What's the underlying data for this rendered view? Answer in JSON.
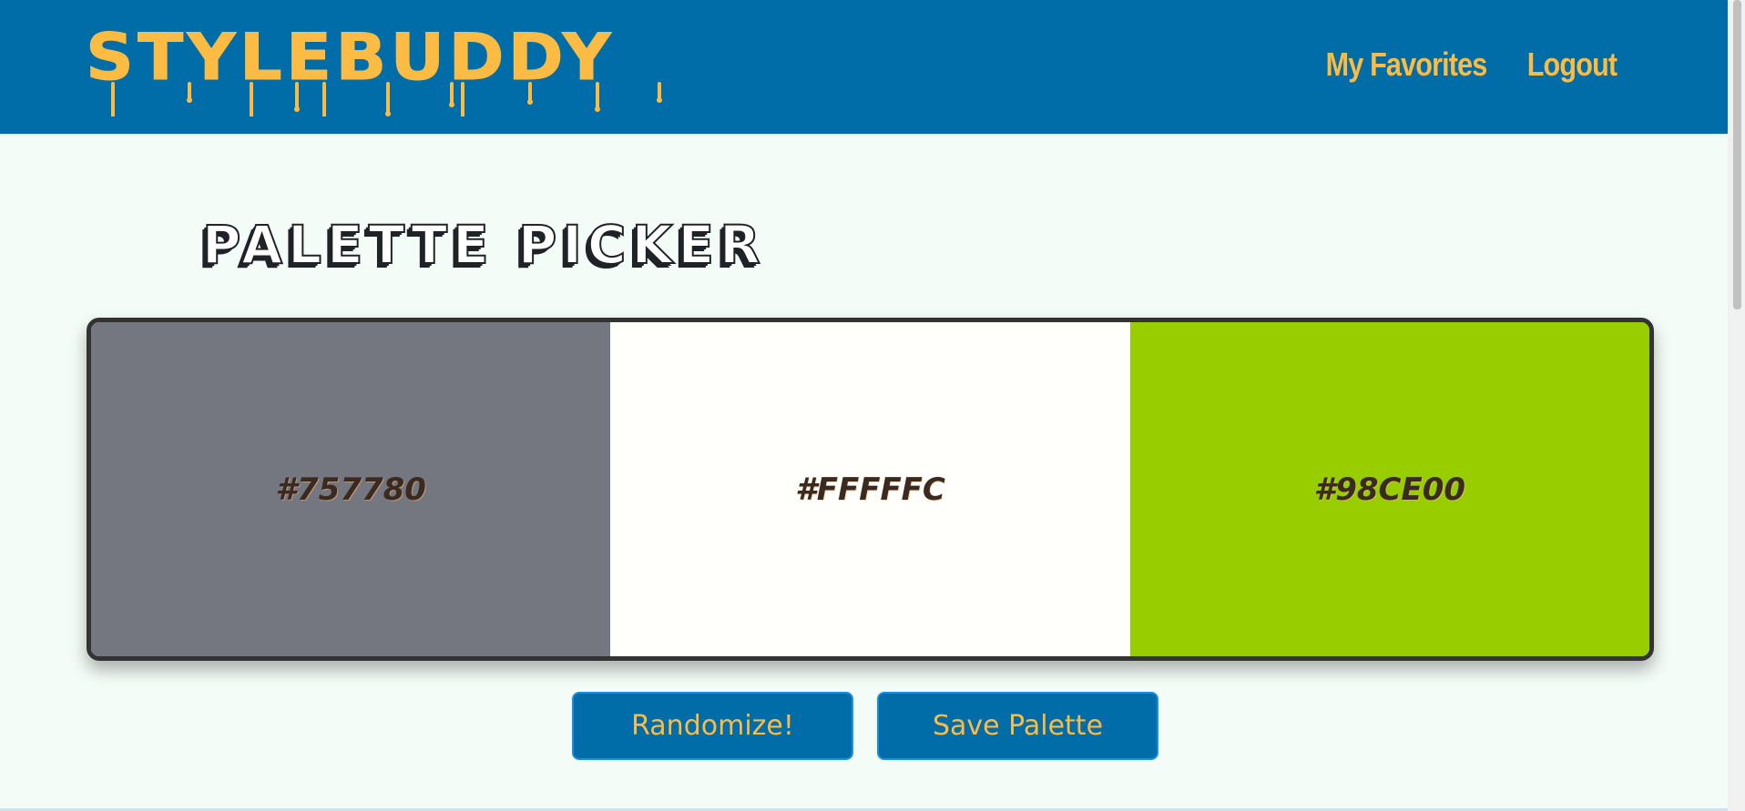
{
  "header": {
    "logo_text": "STYLEBUDDY",
    "nav": [
      {
        "label": "My Favorites"
      },
      {
        "label": "Logout"
      }
    ]
  },
  "main": {
    "title": "PALETTE PICKER",
    "swatches": [
      {
        "hex": "#757780",
        "label": "#757780"
      },
      {
        "hex": "#FFFFFC",
        "label": "#FFFFFC"
      },
      {
        "hex": "#98CE00",
        "label": "#98CE00"
      }
    ],
    "buttons": {
      "randomize_label": "Randomize!",
      "save_label": "Save Palette"
    }
  },
  "colors": {
    "header_bg": "#006ca8",
    "accent": "#fcbb43",
    "page_bg": "#f4fcf7"
  }
}
